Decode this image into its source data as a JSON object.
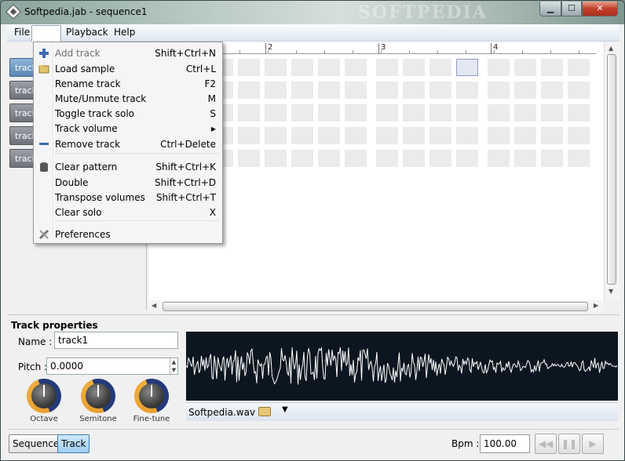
{
  "window": {
    "title": "Softpedia.jab - sequence1",
    "watermark": "SOFTPEDIA"
  },
  "menubar": {
    "items": [
      "File",
      "Playback",
      "Help"
    ]
  },
  "edit_menu": {
    "items": [
      {
        "label": "Add track",
        "shortcut": "Shift+Ctrl+N",
        "icon": "plus-icon"
      },
      {
        "label": "Load sample",
        "shortcut": "Ctrl+L",
        "icon": "folder-icon"
      },
      {
        "label": "Rename track",
        "shortcut": "F2",
        "icon": ""
      },
      {
        "label": "Mute/Unmute track",
        "shortcut": "M",
        "icon": ""
      },
      {
        "label": "Toggle track solo",
        "shortcut": "S",
        "icon": ""
      },
      {
        "label": "Track volume",
        "shortcut": "▸",
        "icon": ""
      },
      {
        "label": "Remove track",
        "shortcut": "Ctrl+Delete",
        "icon": "minus-icon"
      },
      {
        "label": "Clear pattern",
        "shortcut": "Shift+Ctrl+K",
        "icon": "trash-icon"
      },
      {
        "label": "Double",
        "shortcut": "Shift+Ctrl+D",
        "icon": ""
      },
      {
        "label": "Transpose volumes",
        "shortcut": "Shift+Ctrl+T",
        "icon": ""
      },
      {
        "label": "Clear solo",
        "shortcut": "X",
        "icon": ""
      },
      {
        "label": "Preferences",
        "shortcut": "",
        "icon": "wrench-icon"
      }
    ]
  },
  "tracks": {
    "labels": [
      "track",
      "track",
      "track",
      "track",
      "track"
    ]
  },
  "ruler": {
    "marks": [
      "2",
      "3",
      "4"
    ]
  },
  "properties": {
    "title": "Track properties",
    "name_label": "Name :",
    "name_value": "track1",
    "pitch_label": "Pitch :",
    "pitch_value": "0.0000",
    "knobs": [
      "Octave",
      "Semitone",
      "Fine-tune"
    ]
  },
  "waveform": {
    "file_name": "Softpedia.wav"
  },
  "statusbar": {
    "sequence_label": "Sequence",
    "track_label": "Track",
    "bpm_label": "Bpm :",
    "bpm_value": "100.00"
  },
  "colors": {
    "waveform_bg": "#0b1620",
    "waveform_line": "#ffffff",
    "knob_ring": "#e8a030"
  }
}
